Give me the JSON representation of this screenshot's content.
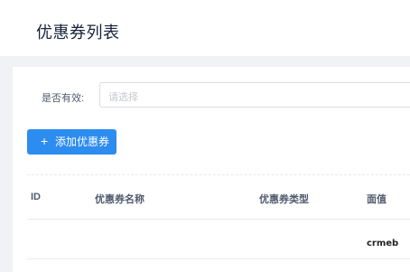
{
  "header": {
    "title": "优惠券列表"
  },
  "filter": {
    "label": "是否有效:",
    "placeholder": "请选择"
  },
  "toolbar": {
    "add_label": "添加优惠券"
  },
  "table": {
    "columns": [
      "ID",
      "优惠券名称",
      "优惠券类型",
      "面值"
    ]
  },
  "brand": {
    "logo_text": "crmeb"
  }
}
